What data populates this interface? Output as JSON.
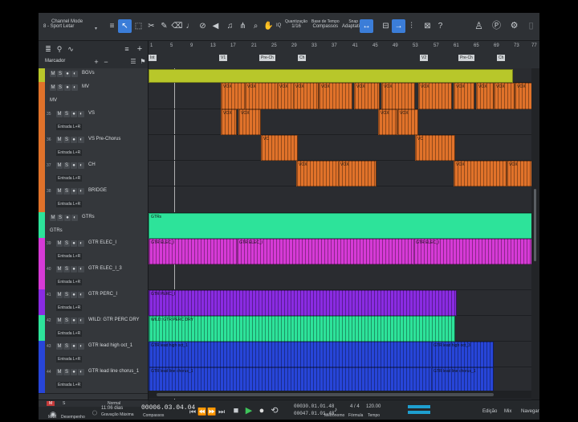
{
  "toolbar": {
    "channel_mode_label": "Channel Mode",
    "channel_mode_value": "8 - Sport Letar",
    "quantize_label": "Quantização",
    "quantize_value": "1/16",
    "timebase_label": "Base de Tempo",
    "timebase_value": "Compassos",
    "snap_label": "Snap",
    "snap_value": "Adaptativo",
    "iq_label": "IQ"
  },
  "tracklist_header": {
    "marker_label": "Marcador"
  },
  "ruler": {
    "ticks": [
      "1",
      "5",
      "9",
      "13",
      "17",
      "21",
      "25",
      "29",
      "33",
      "37",
      "41",
      "45",
      "49",
      "53",
      "57",
      "61",
      "65",
      "69",
      "73",
      "77"
    ],
    "markers": [
      {
        "label": "Int"
      },
      {
        "label": "V1"
      },
      {
        "label": "Pre-Ch"
      },
      {
        "label": "Ch"
      },
      {
        "label": "V2"
      },
      {
        "label": "Pre-Ch"
      },
      {
        "label": "Ch"
      }
    ]
  },
  "tracks": [
    {
      "name": "BGVs",
      "folder": "BGVs",
      "color": "#b8c72a"
    },
    {
      "name": "MV",
      "folder": "MV",
      "color": "#e0722a"
    },
    {
      "num": "35",
      "name": "VS",
      "input": "Entrada L+R",
      "color": "#e0722a"
    },
    {
      "num": "36",
      "name": "VS Pre-Chorus",
      "input": "Entrada L+R",
      "color": "#e0722a"
    },
    {
      "num": "37",
      "name": "CH",
      "input": "Entrada L+R",
      "color": "#e0722a"
    },
    {
      "num": "38",
      "name": "BRIDGE",
      "input": "Entrada L+R",
      "color": "#e0722a"
    },
    {
      "name": "GTRs",
      "folder": "GTRs",
      "color": "#2de39a"
    },
    {
      "num": "39",
      "name": "GTR ELEC_I",
      "input": "Entrada L+R",
      "color": "#d63ad6"
    },
    {
      "num": "40",
      "name": "GTR ELEC_I_3",
      "input": "Entrada L+R",
      "color": "#d63ad6"
    },
    {
      "num": "41",
      "name": "GTR PERC_I",
      "input": "Entrada L+R",
      "color": "#8a2be2"
    },
    {
      "num": "42",
      "name": "WILD: GTR PERC DRY",
      "input": "Entrada L+R",
      "color": "#2de39a"
    },
    {
      "num": "43",
      "name": "GTR lead high oct_1",
      "input": "Entrada L+R",
      "color": "#2745d8"
    },
    {
      "num": "44",
      "name": "GTR lead line chorus_1",
      "input": "Entrada L+R",
      "color": "#2745d8"
    }
  ],
  "clips": {
    "bgvs": "",
    "vox": "VOX",
    "vc": "VC",
    "gtrs": "GTRs",
    "gtr_elec": "GTR ELEC_I",
    "gtr_elec2": "GTR ELEC_I",
    "gtr_elec3": "GTR ELEC_I",
    "gtr_perc": "GTR PERC_I",
    "gtr_dry": "WILD: GTR PERC DRY",
    "gtr_lead": "GTR lead high oct_1",
    "gtr_lead3": "GTR lead high oct_3",
    "gtr_lead_ch": "GTR lead line chorus_1",
    "gtr_lead_ch2": "GTR lead line chorus_1"
  },
  "transport": {
    "midi_label": "MIDI",
    "perf_label": "Desempenho",
    "record_label": "11:06 dias",
    "record_sub": "Gravação Máxima",
    "time_main": "00006.03.04.04",
    "time_sub": "Compassos",
    "loop_start": "00030.01.01.48",
    "loop_end": "00047.01.01.48",
    "metronome_label": "Metrônomo",
    "signature": "4 / 4",
    "signature_label": "Fórmula",
    "tempo": "120.00",
    "tempo_label": "Tempo",
    "edit_tab": "Edição",
    "mix_tab": "Mix",
    "browse_tab": "Navegar",
    "normal_label": "Normal",
    "m_label": "M",
    "s_label": "S"
  },
  "colors": {
    "accent": "#3b7dd8",
    "bgvs": "#b8c72a",
    "vox": "#e0722a",
    "gtrs": "#2de39a",
    "elec": "#d63ad6",
    "perc": "#8a2be2",
    "lead": "#2745d8"
  }
}
